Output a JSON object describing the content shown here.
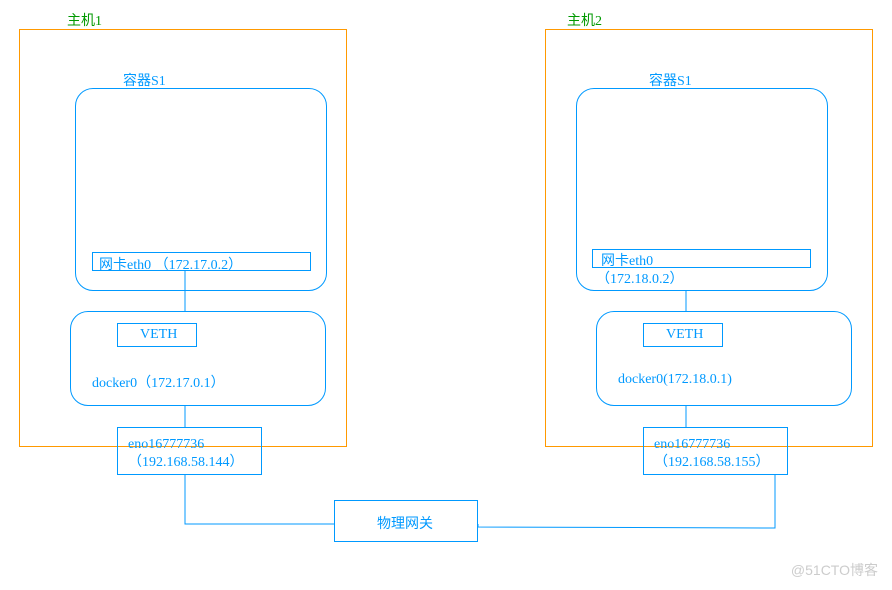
{
  "host1": {
    "title": "主机1",
    "container": {
      "name": "容器S1",
      "eth": "网卡eth0 （172.17.0.2）"
    },
    "bridge": {
      "veth": "VETH",
      "docker0": "docker0（172.17.0.1）"
    },
    "nic": "eno16777736（192.168.58.144）"
  },
  "host2": {
    "title": "主机2",
    "container": {
      "name": "容器S1",
      "eth_line1": "网卡eth0",
      "eth_line2": "（172.18.0.2）"
    },
    "bridge": {
      "veth": "VETH",
      "docker0": "docker0(172.18.0.1)"
    },
    "nic": "eno16777736（192.168.58.155）"
  },
  "gateway": "物理网关",
  "watermark": "@51CTO博客"
}
